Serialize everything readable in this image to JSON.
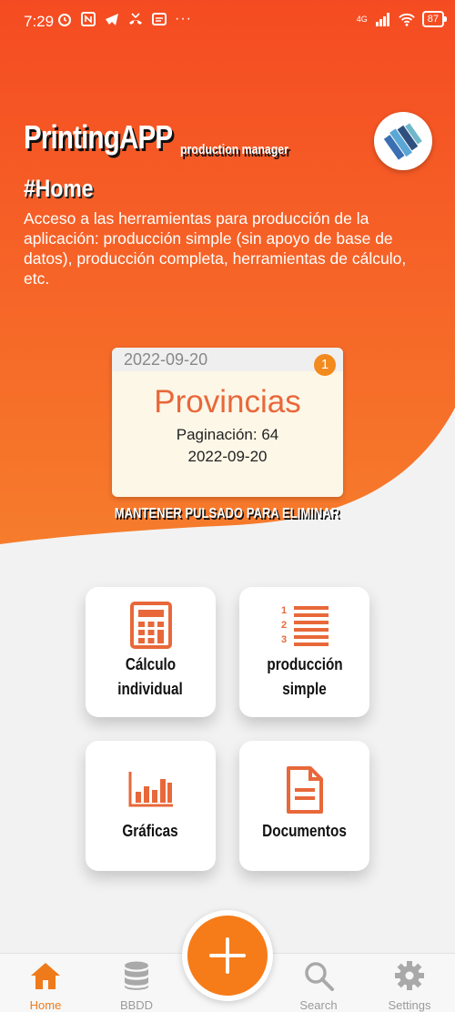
{
  "status_bar": {
    "time": "7:29",
    "network": "4G",
    "battery": "87"
  },
  "header": {
    "app_name": "PrintingAPP",
    "app_subtitle": "production manager",
    "section_title": "#Home",
    "description": "Acceso a las herramientas para producción de la aplicación: producción simple (sin apoyo de base de datos), producción completa, herramientas de cálculo, etc."
  },
  "job_card": {
    "date_header": "2022-09-20",
    "badge_count": "1",
    "name": "Provincias",
    "pagination": "Paginación: 64",
    "date": "2022-09-20"
  },
  "hint": "MANTENER PULSADO PARA ELIMINAR",
  "tiles": [
    {
      "label_line1": "Cálculo",
      "label_line2": "individual",
      "icon": "calculator-icon"
    },
    {
      "label_line1": "producción",
      "label_line2": "simple",
      "icon": "numbered-list-icon"
    },
    {
      "label_line1": "Gráficas",
      "label_line2": "",
      "icon": "bar-chart-icon"
    },
    {
      "label_line1": "Documentos",
      "label_line2": "",
      "icon": "document-icon"
    }
  ],
  "fab": {
    "icon": "plus-icon"
  },
  "nav": [
    {
      "label": "Home",
      "icon": "home-icon",
      "active": true
    },
    {
      "label": "BBDD",
      "icon": "database-icon",
      "active": false
    },
    {
      "label": "Search",
      "icon": "search-icon",
      "active": false
    },
    {
      "label": "Settings",
      "icon": "gear-icon",
      "active": false
    }
  ],
  "colors": {
    "accent": "#F57C18",
    "header_top": "#F54B22",
    "header_bottom": "#F67A2A",
    "icon_orange": "#E8683A",
    "card_bg": "#FDF7E8",
    "background": "#F2F2F2"
  }
}
